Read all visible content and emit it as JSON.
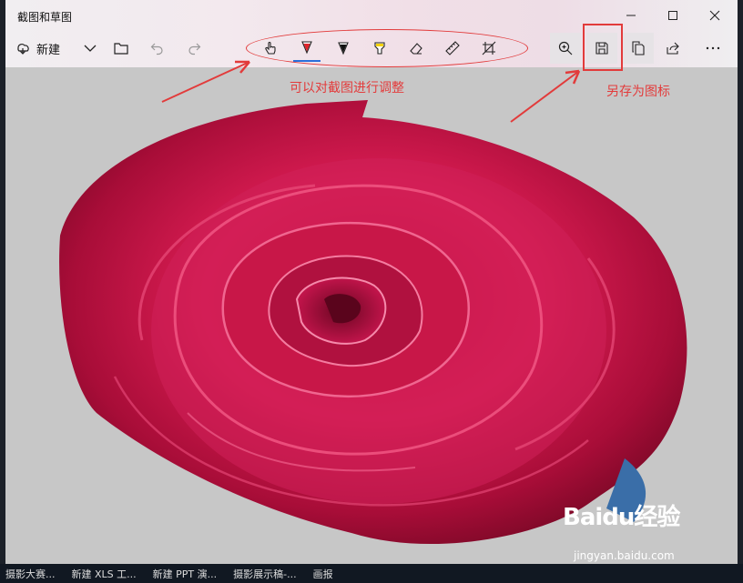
{
  "window": {
    "title": "截图和草图",
    "controls": [
      "minimize",
      "maximize",
      "close"
    ]
  },
  "toolbar": {
    "new_label": "新建",
    "left_icons": [
      "new-snip-icon",
      "chevron-down-icon",
      "folder-icon",
      "undo-icon",
      "redo-icon"
    ],
    "center_tools": [
      "touch-writing-icon",
      "ballpoint-pen-icon",
      "pencil-icon",
      "highlighter-icon",
      "eraser-icon",
      "ruler-icon",
      "crop-icon"
    ],
    "right_tools": [
      "zoom-icon",
      "save-as-icon",
      "copy-icon",
      "share-icon",
      "more-icon"
    ],
    "pen_colors": {
      "ballpoint": "#e0242b",
      "pencil": "#111111",
      "highlighter": "#f5d200",
      "active_underline": "#2a6fdb"
    }
  },
  "annotations": {
    "tools_note": "可以对截图进行调整",
    "save_note": "另存为图标",
    "color": "#e33b3b"
  },
  "taskbar": {
    "items": [
      "摄影大赛...",
      "新建 XLS 工...",
      "新建 PPT 演...",
      "摄影展示稿-...",
      "画报"
    ]
  },
  "watermark": {
    "brand": "Baidu经验",
    "url": "jingyan.baidu.com"
  }
}
